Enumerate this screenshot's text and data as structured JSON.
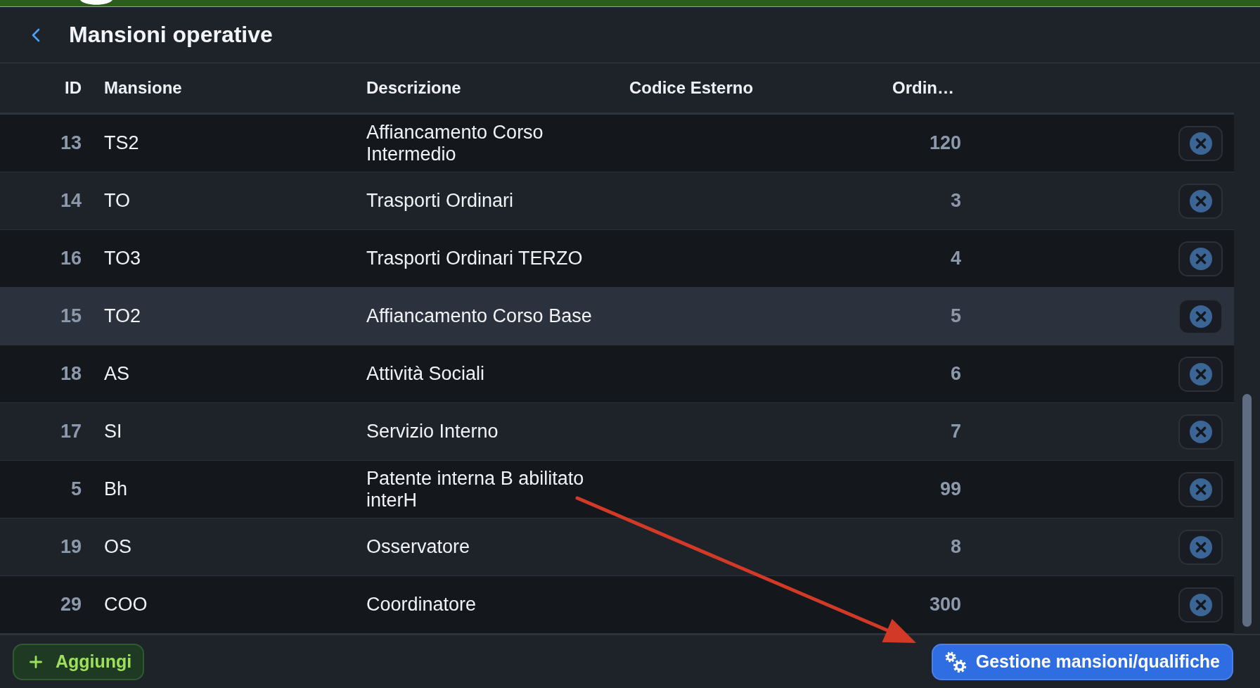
{
  "header": {
    "title": "Mansioni operative"
  },
  "table": {
    "columns": [
      "ID",
      "Mansione",
      "Descrizione",
      "Codice Esterno",
      "Ordin…"
    ],
    "rows": [
      {
        "id": "13",
        "role": "TS2",
        "description": "Affiancamento Corso Intermedio",
        "column_5": "120",
        "highlighted": false
      },
      {
        "id": "14",
        "role": "TO",
        "description": "Trasporti Ordinari",
        "column_5": "3",
        "highlighted": false
      },
      {
        "id": "16",
        "role": "TO3",
        "description": "Trasporti Ordinari TERZO",
        "column_5": "4",
        "highlighted": false
      },
      {
        "id": "15",
        "role": "TO2",
        "description": "Affiancamento Corso Base",
        "column_5": "5",
        "highlighted": true
      },
      {
        "id": "18",
        "role": "AS",
        "description": "Attività Sociali",
        "column_5": "6",
        "highlighted": false
      },
      {
        "id": "17",
        "role": "SI",
        "description": "Servizio Interno",
        "column_5": "7",
        "highlighted": false
      },
      {
        "id": "5",
        "role": "Bh",
        "description": "Patente interna B abilitato interH",
        "column_5": "99",
        "highlighted": false
      },
      {
        "id": "19",
        "role": "OS",
        "description": "Osservatore",
        "column_5": "8",
        "highlighted": false
      },
      {
        "id": "29",
        "role": "COO",
        "description": "Coordinatore",
        "column_5": "300",
        "highlighted": false
      }
    ]
  },
  "footer": {
    "buttons": [
      {
        "label": "Aggiungi",
        "kind": "add"
      },
      {
        "label": "Gestione mansioni/qualifiche",
        "kind": "manage"
      }
    ]
  }
}
